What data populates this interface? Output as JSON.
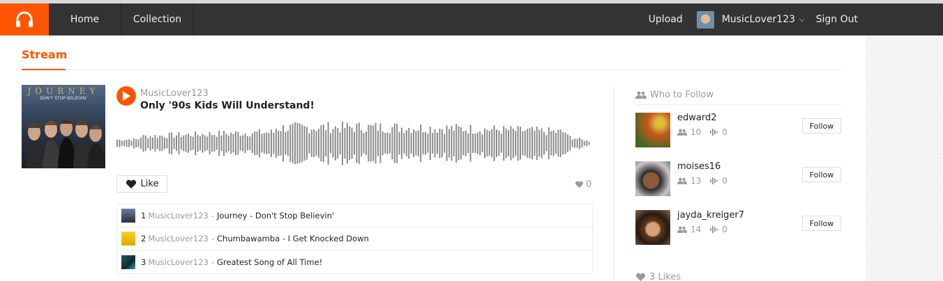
{
  "nav": {
    "home": "Home",
    "collection": "Collection",
    "upload": "Upload",
    "username": "MusicLover123",
    "sign_out": "Sign Out"
  },
  "stream": {
    "title": "Stream"
  },
  "track": {
    "cover_title": "JOURNEY",
    "cover_subtitle": "DON'T STOP BELIEVIN'",
    "user": "MusicLover123",
    "title": "Only '90s Kids Will Understand!",
    "like_label": "Like",
    "like_count": "0"
  },
  "playlist": [
    {
      "num": "1",
      "user": "MusicLover123",
      "sep": "-",
      "track": "Journey - Don't Stop Believin'"
    },
    {
      "num": "2",
      "user": "MusicLover123",
      "sep": "-",
      "track": "Chumbawamba - I Get Knocked Down"
    },
    {
      "num": "3",
      "user": "MusicLover123",
      "sep": "-",
      "track": "Greatest Song of All Time!"
    }
  ],
  "who_to_follow": {
    "header": "Who to Follow",
    "follow_label": "Follow",
    "users": [
      {
        "name": "edward2",
        "followers": "10",
        "tracks": "0"
      },
      {
        "name": "moises16",
        "followers": "13",
        "tracks": "0"
      },
      {
        "name": "jayda_kreiger7",
        "followers": "14",
        "tracks": "0"
      }
    ]
  },
  "likes": {
    "label": "3 Likes"
  },
  "colors": {
    "accent": "#ff5500",
    "navbar": "#333333"
  },
  "icons": [
    "headphones-icon",
    "chevron-down-icon",
    "play-icon",
    "heart-icon",
    "users-icon",
    "waveform-icon"
  ]
}
